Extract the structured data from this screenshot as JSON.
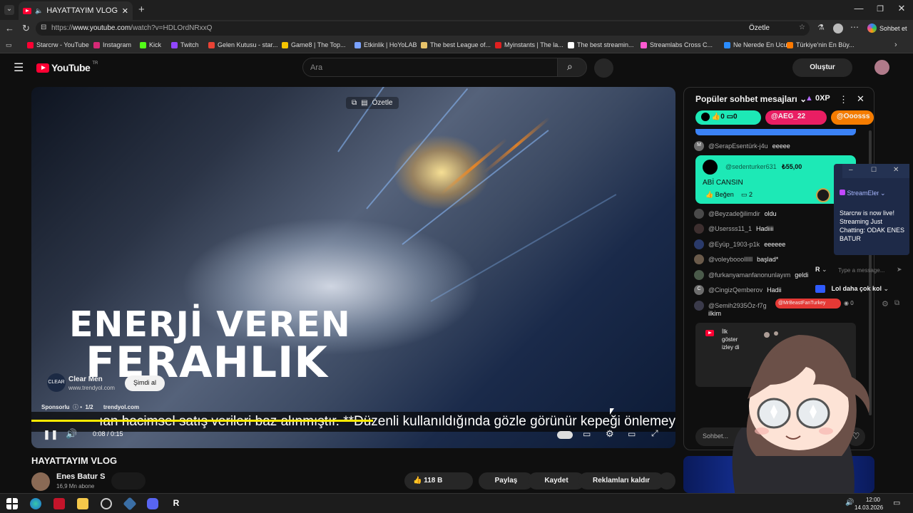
{
  "browser": {
    "tab_title": "HAYATTAYIM VLOG - YouTube",
    "url_prefix": "https://",
    "url_host": "www.youtube.com",
    "url_path": "/watch?v=HDLOrdNRxxQ",
    "ozetle": "Özetle",
    "copilot": "Sohbet et",
    "bookmarks": [
      {
        "label": "Starcrw - YouTube",
        "color": "#ff0033"
      },
      {
        "label": "Instagram",
        "color": "#d62976"
      },
      {
        "label": "Kick",
        "color": "#53fc18"
      },
      {
        "label": "Twitch",
        "color": "#9146ff"
      },
      {
        "label": "Gelen Kutusu - star...",
        "color": "#ea4335"
      },
      {
        "label": "Game8 | The Top...",
        "color": "#f5c400"
      },
      {
        "label": "Etkinlik | HoYoLAB",
        "color": "#7aa2ff"
      },
      {
        "label": "The best League of...",
        "color": "#e8c36a"
      },
      {
        "label": "Myinstants | The la...",
        "color": "#e02020"
      },
      {
        "label": "The best streamin...",
        "color": "#ffffff"
      },
      {
        "label": "Streamlabs Cross C...",
        "color": "#ff5ad1"
      },
      {
        "label": "Ne Nerede En Ucu...",
        "color": "#2a8cff"
      },
      {
        "label": "Türkiye'nin En Büy...",
        "color": "#ff7a00"
      }
    ]
  },
  "youtube": {
    "logo_text": "YouTube",
    "region": "TR",
    "search_placeholder": "Ara",
    "create_label": "Oluştur"
  },
  "video": {
    "ozetle_chip": "Özetle",
    "overlay_line1": "ENERJİ VEREN",
    "overlay_line2": "FERAHLIK",
    "ad_logo": "CLEAR",
    "ad_name": "Clear Men",
    "ad_url": "www.trendyol.com",
    "ad_button": "Şimdi al",
    "ad_sponsored": "Sponsorlu",
    "ad_count": "1/2",
    "ad_domain": "trendyol.com",
    "subtitle": "ıan hacimsel satış verileri baz alınmıştır. **Düzenli kullanıldığında gözle görünür kepeği önlemey",
    "time": "0:08 / 0:15",
    "progress": 0.53
  },
  "below": {
    "title": "HAYATTAYIM VLOG",
    "channel": "Enes Batur S",
    "subs": "16,9 Mn abone",
    "likes": "118 B",
    "share": "Paylaş",
    "save": "Kaydet",
    "remove_ads": "Reklamları kaldır"
  },
  "chat": {
    "title": "Popüler sohbet mesajları",
    "xp": "0XP",
    "tickets": [
      {
        "label": "0",
        "label2": "0",
        "color": "#1de9b6"
      },
      {
        "label": "@AEG_22",
        "color": "#e91e63"
      },
      {
        "label": "@Ooosss",
        "color": "#f57c00"
      }
    ],
    "messages": [
      {
        "author": "@SerapEsentürk-j4u",
        "text": "eeeee",
        "initial": "M"
      },
      {
        "author": "@Beyzadeğilimdir",
        "text": "oldu",
        "initial": ""
      },
      {
        "author": "@Usersss11_1",
        "text": "Hadiiii",
        "initial": ""
      },
      {
        "author": "@Eyüp_1903-p1k",
        "text": "eeeeee",
        "initial": ""
      },
      {
        "author": "@voleybooollllll",
        "text": "başlad*",
        "initial": ""
      },
      {
        "author": "@furkanyamanfanonunlayım",
        "text": "geldi",
        "initial": ""
      },
      {
        "author": "@CingizQemberov",
        "text": "Hadii",
        "initial": "C"
      },
      {
        "author": "@Semih2935Öz-f7g",
        "text": "ilkim",
        "initial": ""
      }
    ],
    "superchat": {
      "author": "@sedenturker631",
      "amount": "₺55,00",
      "text": "ABİ CANSIN",
      "like": "Beğen",
      "replies": "2"
    },
    "pinned_preview": "İlk göster izley di",
    "input_placeholder": "Sohbet..."
  },
  "overlay": {
    "title": "StreamElements",
    "notification": "Starcrw is now live! Streaming Just Chatting: ODAK ENES BATUR",
    "input_placeholder": "Type a message...",
    "channel_label": "Lol daha çok kol",
    "user_chip": "@MrBeastFanTurkey",
    "viewers": "0",
    "initial": "R"
  },
  "taskbar": {
    "time": "12:00",
    "date": "14.03.2026"
  }
}
